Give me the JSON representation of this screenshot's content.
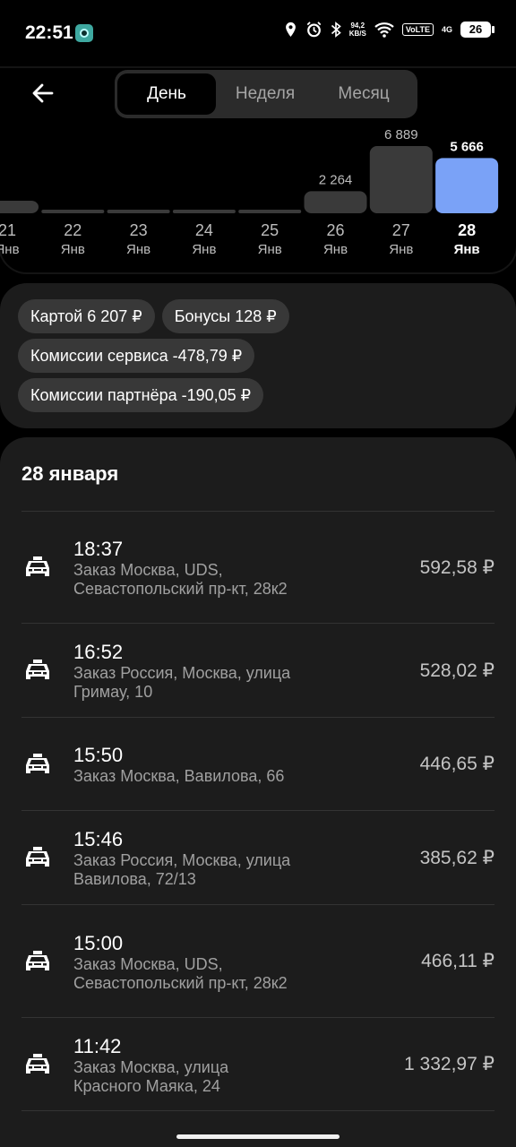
{
  "status_bar": {
    "time": "22:51",
    "net_speed_value": "94,2",
    "net_speed_unit": "KB/S",
    "volte": "VoLTE",
    "network": "4G",
    "battery": "26"
  },
  "header": {
    "tabs": [
      {
        "label": "День",
        "active": true
      },
      {
        "label": "Неделя",
        "active": false
      },
      {
        "label": "Месяц",
        "active": false
      }
    ]
  },
  "chart_data": {
    "type": "bar",
    "categories": [
      "21 Янв",
      "22 Янв",
      "23 Янв",
      "24 Янв",
      "25 Янв",
      "26 Янв",
      "27 Янв",
      "28 Янв"
    ],
    "days": [
      "21",
      "22",
      "23",
      "24",
      "25",
      "26",
      "27",
      "28"
    ],
    "months": [
      "Янв",
      "Янв",
      "Янв",
      "Янв",
      "Янв",
      "Янв",
      "Янв",
      "Янв"
    ],
    "values": [
      150,
      0,
      0,
      0,
      0,
      2264,
      6889,
      5666
    ],
    "value_labels": [
      "",
      "",
      "",
      "",
      "",
      "2 264",
      "6 889",
      "5 666"
    ],
    "selected_index": 7,
    "selected_color": "#7aa2f7",
    "bar_color": "#3a3a3a"
  },
  "summary": {
    "chips": [
      [
        "Картой 6 207 ₽",
        "Бонусы 128 ₽"
      ],
      [
        "Комиссии сервиса -478,79 ₽"
      ],
      [
        "Комиссии партнёра -190,05 ₽"
      ]
    ]
  },
  "orders": {
    "date_title": "28 января",
    "items": [
      {
        "time": "18:37",
        "address": "Заказ Москва, UDS, Севастопольский пр-кт, 28к2",
        "amount": "592,58 ₽"
      },
      {
        "time": "16:52",
        "address": "Заказ Россия, Москва, улица Гримау, 10",
        "amount": "528,02 ₽"
      },
      {
        "time": "15:50",
        "address": "Заказ Москва, Вавилова, 66",
        "amount": "446,65 ₽"
      },
      {
        "time": "15:46",
        "address": "Заказ Россия, Москва, улица Вавилова, 72/13",
        "amount": "385,62 ₽"
      },
      {
        "time": "15:00",
        "address": "Заказ Москва, UDS, Севастопольский пр-кт, 28к2",
        "amount": "466,11 ₽"
      },
      {
        "time": "11:42",
        "address": "Заказ Москва, улица Красного Маяка, 24",
        "amount": "1 332,97 ₽"
      }
    ]
  },
  "icons": {
    "back": "arrow-left-icon",
    "order": "taxi-car-icon"
  }
}
